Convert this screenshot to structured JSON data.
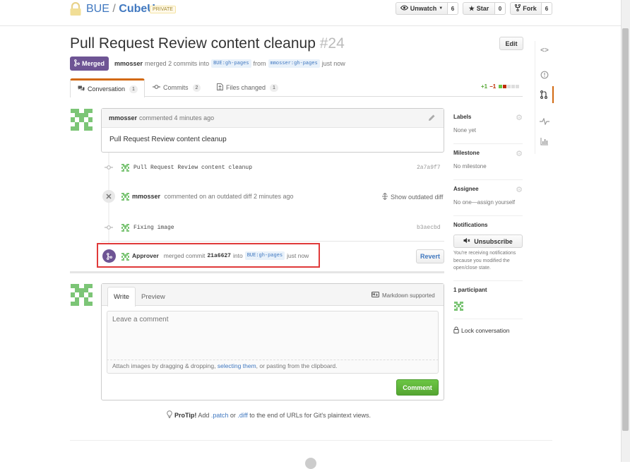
{
  "repo": {
    "owner": "BUE",
    "separator": "/",
    "name": "CubeU",
    "visibility": "PRIVATE"
  },
  "repo_actions": {
    "watch": {
      "label": "Unwatch",
      "count": "6"
    },
    "star": {
      "label": "Star",
      "count": "0"
    },
    "fork": {
      "label": "Fork",
      "count": "6"
    }
  },
  "pr": {
    "title": "Pull Request Review content cleanup",
    "number": "#24",
    "edit_label": "Edit",
    "state": "Merged",
    "author": "mmosser",
    "summary_1": "merged 2 commits into",
    "base_branch": "BUE:gh-pages",
    "summary_2": "from",
    "head_branch": "mmosser:gh-pages",
    "summary_3": "just now"
  },
  "tabs": [
    {
      "label": "Conversation",
      "count": "1"
    },
    {
      "label": "Commits",
      "count": "2"
    },
    {
      "label": "Files changed",
      "count": "1"
    }
  ],
  "diffstat": {
    "additions": "+1",
    "deletions": "−1"
  },
  "comment": {
    "author": "mmosser",
    "meta": "commented 4 minutes ago",
    "body": "Pull Request Review content cleanup"
  },
  "timeline": {
    "commit1": {
      "message": "Pull Request Review content cleanup",
      "sha": "2a7a9f7"
    },
    "outdated": {
      "author": "mmosser",
      "text": "commented on an outdated diff 2 minutes ago",
      "toggle": "Show outdated diff"
    },
    "commit2": {
      "message": "Fixing image",
      "sha": "b3aecbd"
    },
    "merge": {
      "actor": "Approver",
      "text_1": "merged commit",
      "sha": "21a6627",
      "text_2": "into",
      "branch": "BUE:gh-pages",
      "time": "just now",
      "revert_label": "Revert"
    }
  },
  "composer": {
    "tab_write": "Write",
    "tab_preview": "Preview",
    "markdown_note": "Markdown supported",
    "placeholder": "Leave a comment",
    "attach_1": "Attach images by dragging & dropping, ",
    "attach_link": "selecting them",
    "attach_2": ", or pasting from the clipboard.",
    "submit_label": "Comment"
  },
  "protip": {
    "label": "ProTip!",
    "text_1": " Add ",
    "link_1": ".patch",
    "text_2": " or ",
    "link_2": ".diff",
    "text_3": " to the end of URLs for Git's plaintext views."
  },
  "sidebar": {
    "labels": {
      "heading": "Labels",
      "value": "None yet"
    },
    "milestone": {
      "heading": "Milestone",
      "value": "No milestone"
    },
    "assignee": {
      "heading": "Assignee",
      "value": "No one—assign yourself"
    },
    "notifications": {
      "heading": "Notifications",
      "button": "Unsubscribe",
      "note": "You're receiving notifications because you modified the open/close state."
    },
    "participants": {
      "heading": "1 participant"
    },
    "lock": "Lock conversation"
  },
  "colors": {
    "merged_purple": "#6e5494",
    "link_blue": "#4078c0",
    "highlight_red": "#e03a3a",
    "comment_green": "#55a532",
    "repo_nav_active": "#d26911"
  },
  "icons": {
    "repo": "lock-icon",
    "repo_nav": [
      "code-icon",
      "issue-icon",
      "pull-request-icon",
      "pulse-icon",
      "graph-icon"
    ]
  }
}
